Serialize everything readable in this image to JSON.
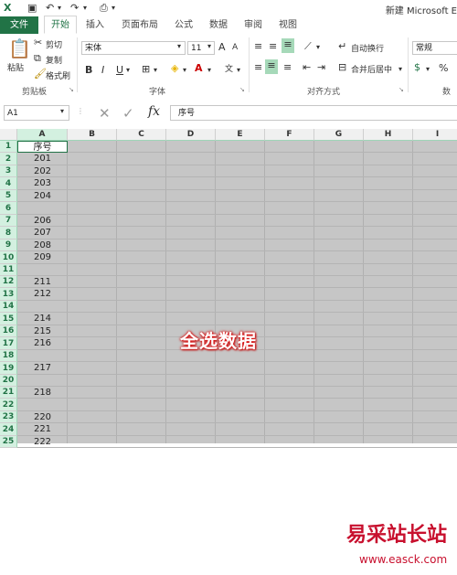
{
  "title_bar": {
    "title": "新建 Microsoft E"
  },
  "tabs": [
    "文件",
    "开始",
    "插入",
    "页面布局",
    "公式",
    "数据",
    "审阅",
    "视图"
  ],
  "ribbon": {
    "clipboard": {
      "paste": "粘贴",
      "cut": "剪切",
      "copy": "复制",
      "format_painter": "格式刷",
      "group_label": "剪贴板"
    },
    "font": {
      "font_name": "宋体",
      "font_size": "11",
      "bold": "B",
      "italic": "I",
      "underline": "U",
      "grow": "A",
      "shrink": "A",
      "group_label": "字体"
    },
    "alignment": {
      "wrap_text": "自动换行",
      "merge_center": "合并后居中",
      "group_label": "对齐方式"
    },
    "number": {
      "format": "常规",
      "percent": "%",
      "group_label": "数字"
    }
  },
  "formula_bar": {
    "name_box": "A1",
    "fx": "fx",
    "content": "序号"
  },
  "columns": [
    "A",
    "B",
    "C",
    "D",
    "E",
    "F",
    "G",
    "H",
    "I"
  ],
  "rows": [
    "1",
    "2",
    "3",
    "4",
    "5",
    "6",
    "7",
    "8",
    "9",
    "10",
    "11",
    "12",
    "13",
    "14",
    "15",
    "16",
    "17",
    "18",
    "19",
    "20",
    "21",
    "22",
    "23",
    "24",
    "25"
  ],
  "column_a": [
    "序号",
    "201",
    "202",
    "203",
    "204",
    "",
    "206",
    "207",
    "208",
    "209",
    "",
    "211",
    "212",
    "",
    "214",
    "215",
    "216",
    "",
    "217",
    "",
    "218",
    "",
    "220",
    "221",
    "222"
  ],
  "overlay_text": "全选数据",
  "watermark": {
    "cn": "易采站长站",
    "url": "www.easck.com"
  },
  "colors": {
    "accent": "#217346",
    "selection": "#c6c6c6",
    "overlay_glow": "#dd1111"
  }
}
